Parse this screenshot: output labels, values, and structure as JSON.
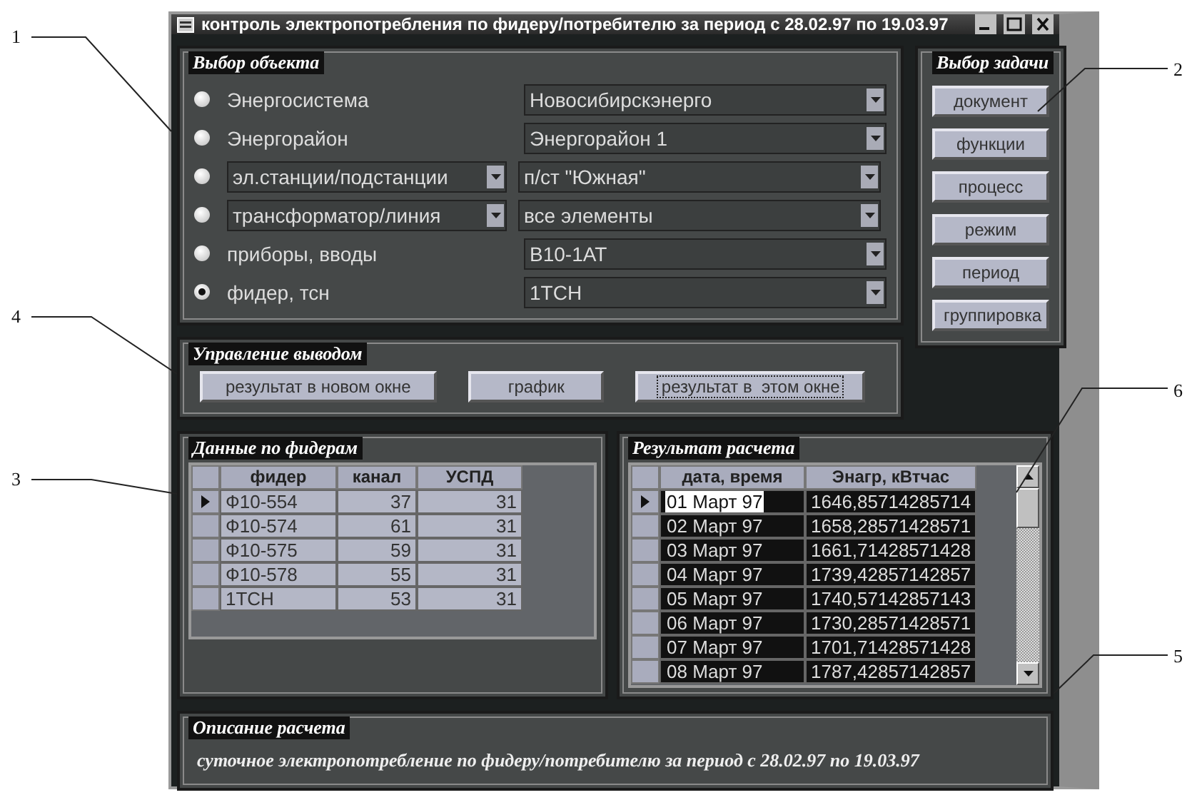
{
  "window": {
    "title": "контроль электропотребления по фидеру/потребителю за период с 28.02.97 по 19.03.97"
  },
  "object_selection": {
    "title": "Выбор объекта",
    "options": [
      {
        "kind": "label",
        "label": "Энергосистема",
        "selected": false,
        "value": "Новосибирскэнерго"
      },
      {
        "kind": "label",
        "label": "Энергорайон",
        "selected": false,
        "value": "Энергорайон 1"
      },
      {
        "kind": "dropdown",
        "label": "эл.станции/подстанции",
        "selected": false,
        "value": "п/ст \"Южная\""
      },
      {
        "kind": "dropdown",
        "label": "трансформатор/линия",
        "selected": false,
        "value": "все элементы"
      },
      {
        "kind": "label",
        "label": "приборы, вводы",
        "selected": false,
        "value": "В10-1АТ"
      },
      {
        "kind": "label",
        "label": "фидер, тсн",
        "selected": true,
        "value": "1ТСН"
      }
    ]
  },
  "task_selection": {
    "title": "Выбор задачи",
    "buttons": [
      "документ",
      "функции",
      "процесс",
      "режим",
      "период",
      "группировка"
    ]
  },
  "output_control": {
    "title": "Управление выводом",
    "buttons": [
      {
        "label": "результат в новом окне",
        "focused": false
      },
      {
        "label": "график",
        "focused": false
      },
      {
        "label": "результат в  этом окне",
        "focused": true
      }
    ]
  },
  "feeder_data": {
    "title": "Данные по фидерам",
    "columns": [
      "фидер",
      "канал",
      "УСПД"
    ],
    "rows": [
      {
        "selected": true,
        "cells": [
          "Ф10-554",
          "37",
          "31"
        ]
      },
      {
        "selected": false,
        "cells": [
          "Ф10-574",
          "61",
          "31"
        ]
      },
      {
        "selected": false,
        "cells": [
          "Ф10-575",
          "59",
          "31"
        ]
      },
      {
        "selected": false,
        "cells": [
          "Ф10-578",
          "55",
          "31"
        ]
      },
      {
        "selected": false,
        "cells": [
          "1ТСН",
          "53",
          "31"
        ]
      }
    ]
  },
  "results": {
    "title": "Результат  расчета",
    "columns": [
      "дата, время",
      "Энагр, кВтчас"
    ],
    "rows": [
      {
        "selected": true,
        "cells": [
          "01 Март 97",
          "1646,85714285714"
        ]
      },
      {
        "selected": false,
        "cells": [
          "02 Март 97",
          "1658,28571428571"
        ]
      },
      {
        "selected": false,
        "cells": [
          "03 Март 97",
          "1661,71428571428"
        ]
      },
      {
        "selected": false,
        "cells": [
          "04 Март 97",
          "1739,42857142857"
        ]
      },
      {
        "selected": false,
        "cells": [
          "05 Март 97",
          "1740,57142857143"
        ]
      },
      {
        "selected": false,
        "cells": [
          "06 Март 97",
          "1730,28571428571"
        ]
      },
      {
        "selected": false,
        "cells": [
          "07 Март 97",
          "1701,71428571428"
        ]
      },
      {
        "selected": false,
        "cells": [
          "08 Март 97",
          "1787,42857142857"
        ]
      }
    ]
  },
  "description": {
    "title": "Описание расчета",
    "text": "суточное электропотребление по фидеру/потребителю за период с 28.02.97 по 19.03.97"
  },
  "callouts": [
    {
      "label": "1"
    },
    {
      "label": "2"
    },
    {
      "label": "4"
    },
    {
      "label": "3"
    },
    {
      "label": "6"
    },
    {
      "label": "5"
    }
  ]
}
